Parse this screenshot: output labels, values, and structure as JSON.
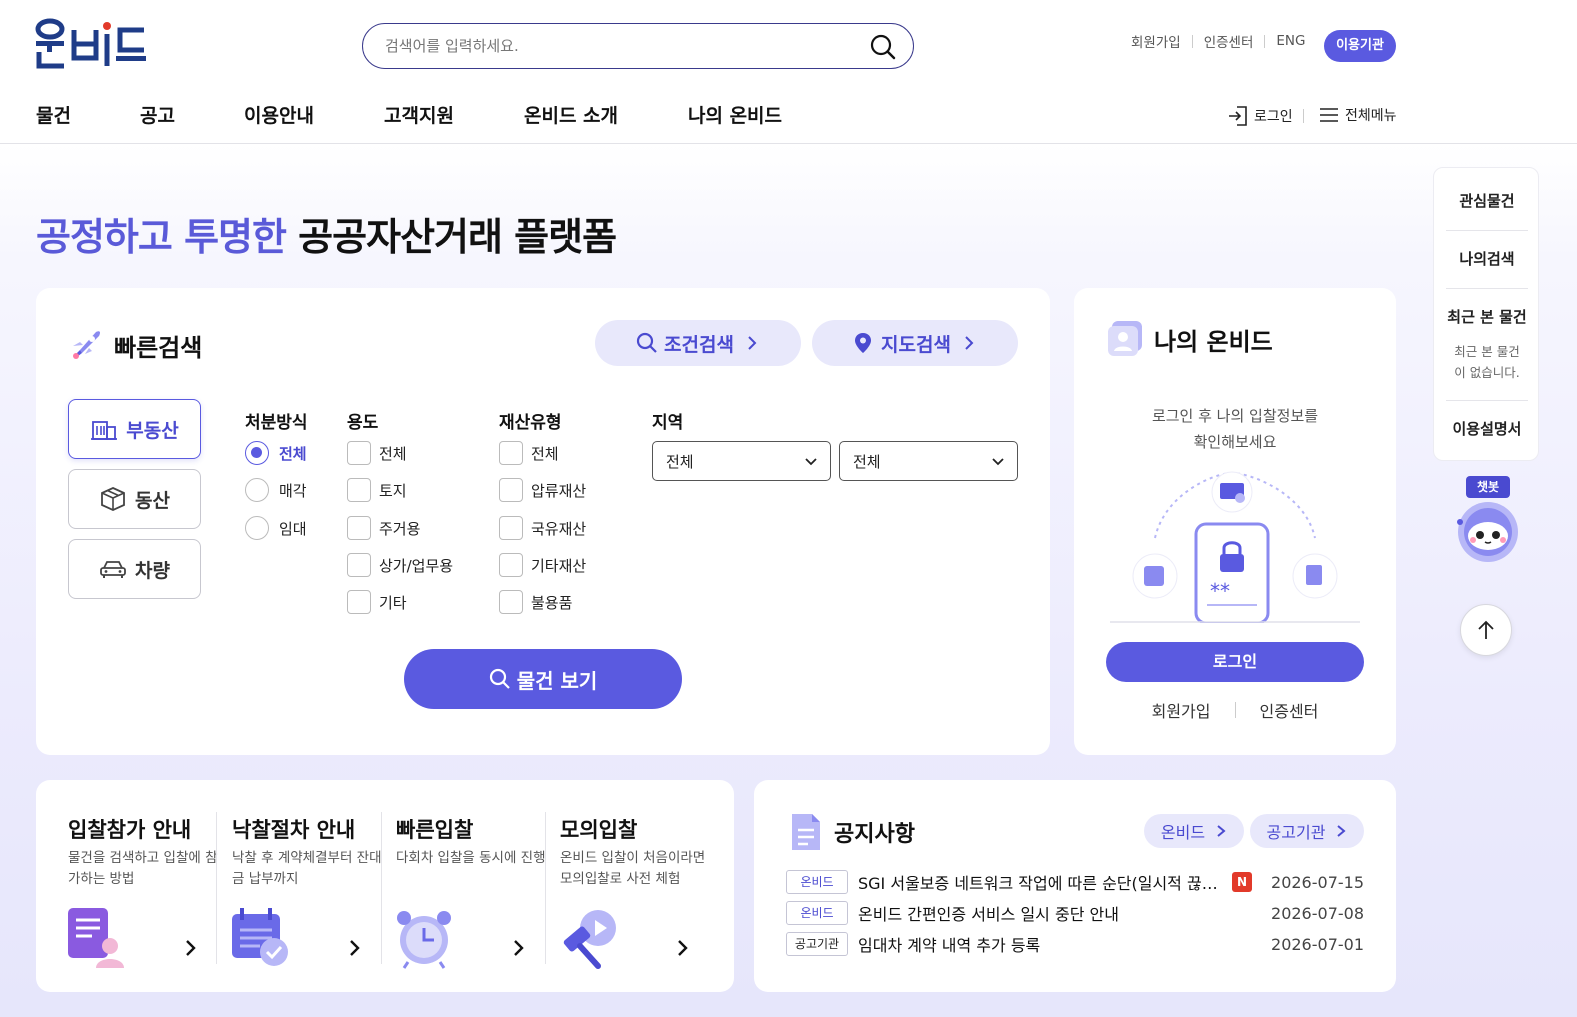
{
  "header": {
    "logo_text": "온비드",
    "search_placeholder": "검색어를 입력하세요.",
    "util_links": [
      "회원가입",
      "인증센터",
      "ENG"
    ],
    "institution_button": "이용기관",
    "nav": [
      "물건",
      "공고",
      "이용안내",
      "고객지원",
      "온비드 소개",
      "나의 온비드"
    ],
    "login": "로그인",
    "all_menu": "전체메뉴"
  },
  "hero": {
    "accent": "공정하고 투명한",
    "rest": " 공공자산거래 플랫폼"
  },
  "quick_search": {
    "title": "빠른검색",
    "condition_search": "조건검색",
    "map_search": "지도검색",
    "categories": [
      "부동산",
      "동산",
      "차량"
    ],
    "active_category": "부동산",
    "disposal": {
      "label": "처분방식",
      "options": [
        "전체",
        "매각",
        "임대"
      ],
      "selected": "전체"
    },
    "usage": {
      "label": "용도",
      "options": [
        "전체",
        "토지",
        "주거용",
        "상가/업무용",
        "기타"
      ]
    },
    "asset_type": {
      "label": "재산유형",
      "options": [
        "전체",
        "압류재산",
        "국유재산",
        "기타재산",
        "불용품"
      ]
    },
    "region": {
      "label": "지역",
      "select1": "전체",
      "select2": "전체"
    },
    "view_button": "물건 보기"
  },
  "my_onbid": {
    "title": "나의 온비드",
    "message_line1": "로그인 후 나의 입찰정보를",
    "message_line2": "확인해보세요",
    "login_button": "로그인",
    "join": "회원가입",
    "cert": "인증센터"
  },
  "guides": [
    {
      "title": "입찰참가 안내",
      "desc": "물건을 검색하고 입찰에 참가하는 방법"
    },
    {
      "title": "낙찰절차 안내",
      "desc": "낙찰 후 계약체결부터 잔대금 납부까지"
    },
    {
      "title": "빠른입찰",
      "desc": "다회차 입찰을 동시에 진행"
    },
    {
      "title": "모의입찰",
      "desc": "온비드 입찰이 처음이라면 모의입찰로 사전 체험"
    }
  ],
  "notices": {
    "title": "공지사항",
    "tabs": [
      "온비드",
      "공고기관"
    ],
    "new_badge": "N",
    "items": [
      {
        "tag": "온비드",
        "text": "SGI 서울보증 네트워크 작업에 따른 순단(일시적 끊김) 안내",
        "is_new": true,
        "date": "2026-07-15"
      },
      {
        "tag": "온비드",
        "text": "온비드 간편인증 서비스 일시 중단 안내",
        "is_new": false,
        "date": "2026-07-08"
      },
      {
        "tag": "공고기관",
        "text": "임대차 계약 내역 추가 등록",
        "is_new": false,
        "date": "2026-07-01"
      }
    ]
  },
  "quickbar": {
    "favorites": "관심물건",
    "my_search": "나의검색",
    "recent": "최근 본 물건",
    "recent_empty_line1": "최근 본 물건",
    "recent_empty_line2": "이 없습니다.",
    "manual": "이용설명서",
    "chatbot": "챗봇"
  },
  "colors": {
    "primary": "#5a5ae0",
    "accent_text": "#5a5ad8",
    "soft": "#e8e8fb",
    "new": "#e23a2a"
  }
}
